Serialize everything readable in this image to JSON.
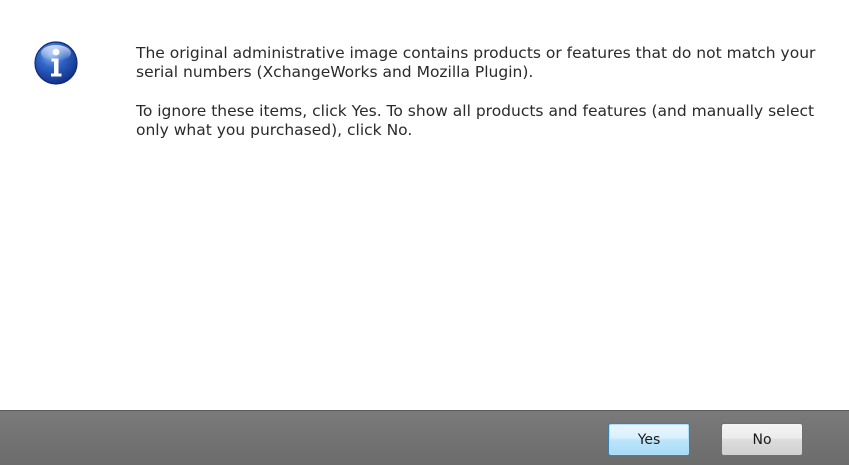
{
  "dialog": {
    "icon": "info-icon",
    "message_line1": "The original administrative image contains products or features that do not match your serial numbers (XchangeWorks and Mozilla Plugin).",
    "message_line2": "To ignore these items, click Yes. To show all products and features (and manually select only what you purchased), click No."
  },
  "buttons": {
    "yes_label": "Yes",
    "no_label": "No"
  },
  "colors": {
    "icon_blue": "#1b4fb0",
    "footer_gray": "#747474",
    "text": "#2a2a2a"
  }
}
